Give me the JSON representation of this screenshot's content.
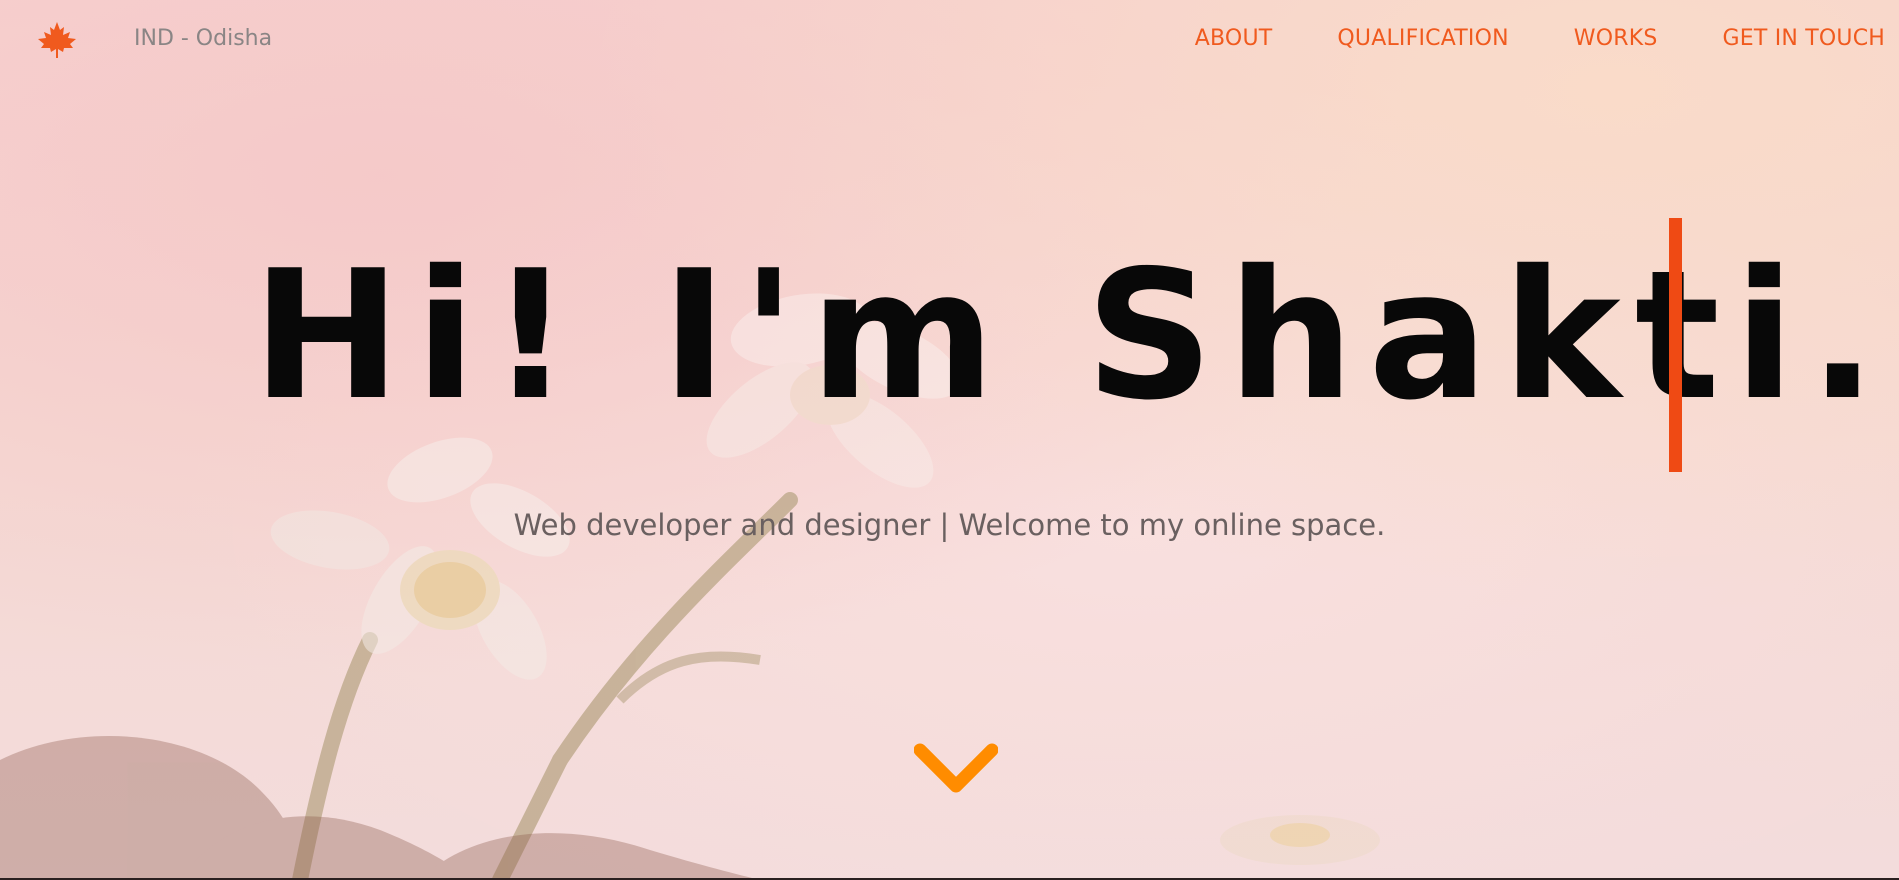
{
  "header": {
    "logo_icon": "maple-leaf-icon",
    "location": "IND - Odisha",
    "nav": [
      {
        "label": "ABOUT"
      },
      {
        "label": "QUALIFICATION"
      },
      {
        "label": "WORKS"
      },
      {
        "label": "GET IN TOUCH"
      }
    ]
  },
  "hero": {
    "title": "Hi! I'm Shakti.",
    "subtitle": "Web developer and designer | Welcome to my online space.",
    "scroll_icon": "chevron-down-icon"
  },
  "colors": {
    "accent": "#f05a1e",
    "cursor": "#ef4a14",
    "chevron": "#ff8c00",
    "title": "#080808"
  }
}
